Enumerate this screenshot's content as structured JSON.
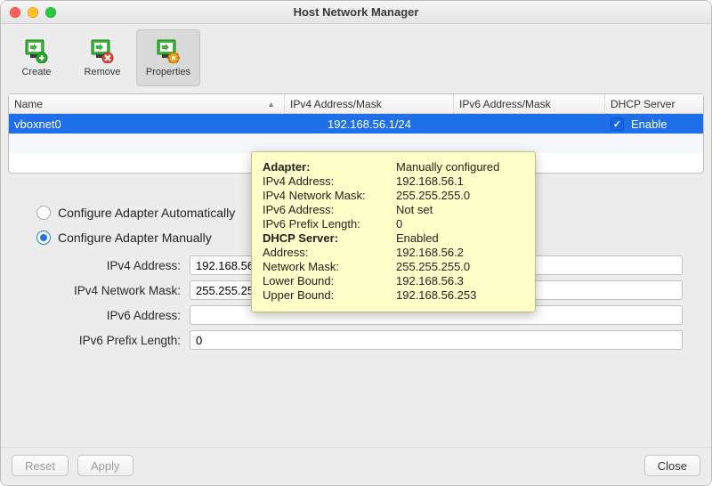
{
  "window": {
    "title": "Host Network Manager"
  },
  "toolbar": {
    "create": "Create",
    "remove": "Remove",
    "properties": "Properties"
  },
  "table": {
    "headers": {
      "name": "Name",
      "ipv4": "IPv4 Address/Mask",
      "ipv6": "IPv6 Address/Mask",
      "dhcp": "DHCP Server"
    },
    "rows": [
      {
        "name": "vboxnet0",
        "ipv4": "192.168.56.1/24",
        "ipv6": "",
        "dhcp_checked": true,
        "dhcp_label": "Enable"
      }
    ]
  },
  "props": {
    "radio_auto": "Configure Adapter Automatically",
    "radio_manual": "Configure Adapter Manually",
    "fields": {
      "ipv4_addr_label": "IPv4 Address:",
      "ipv4_addr_value": "192.168.56.1",
      "ipv4_mask_label": "IPv4 Network Mask:",
      "ipv4_mask_value": "255.255.255.0",
      "ipv6_addr_label": "IPv6 Address:",
      "ipv6_addr_value": "",
      "ipv6_plen_label": "IPv6 Prefix Length:",
      "ipv6_plen_value": "0"
    }
  },
  "buttons": {
    "reset": "Reset",
    "apply": "Apply",
    "close": "Close"
  },
  "tooltip": {
    "rows": [
      {
        "k": "Adapter:",
        "v": "Manually configured",
        "bold": true
      },
      {
        "k": "IPv4 Address:",
        "v": "192.168.56.1",
        "bold": false
      },
      {
        "k": "IPv4 Network Mask:",
        "v": "255.255.255.0",
        "bold": false
      },
      {
        "k": "IPv6 Address:",
        "v": "Not set",
        "bold": false
      },
      {
        "k": "IPv6 Prefix Length:",
        "v": "0",
        "bold": false
      },
      {
        "k": "DHCP Server:",
        "v": "Enabled",
        "bold": true
      },
      {
        "k": "Address:",
        "v": "192.168.56.2",
        "bold": false
      },
      {
        "k": "Network Mask:",
        "v": "255.255.255.0",
        "bold": false
      },
      {
        "k": "Lower Bound:",
        "v": "192.168.56.3",
        "bold": false
      },
      {
        "k": "Upper Bound:",
        "v": "192.168.56.253",
        "bold": false
      }
    ]
  },
  "colors": {
    "selection": "#1e6fe8",
    "tooltip_bg": "#feffc8"
  }
}
